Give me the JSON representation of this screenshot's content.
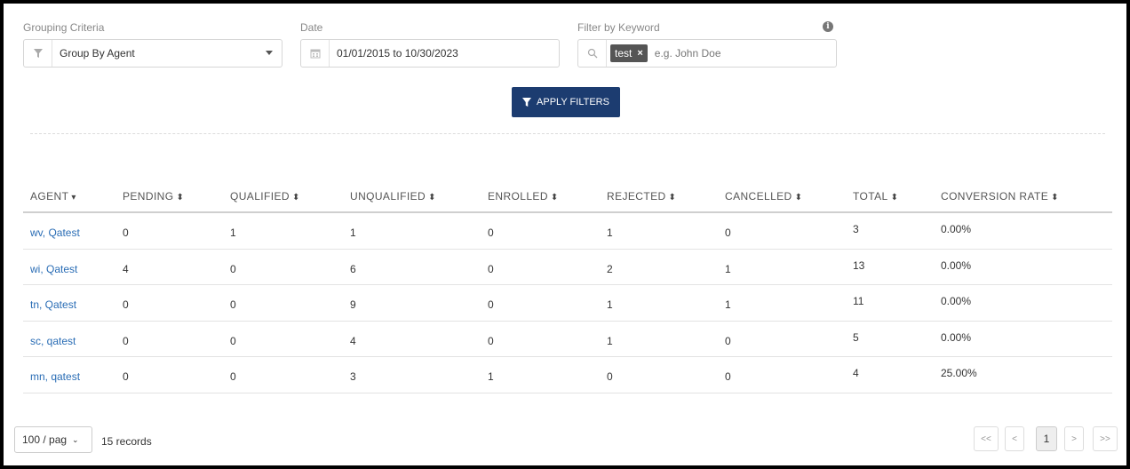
{
  "filters": {
    "grouping": {
      "label": "Grouping Criteria",
      "value": "Group By Agent"
    },
    "date": {
      "label": "Date",
      "value": "01/01/2015 to 10/30/2023"
    },
    "keyword": {
      "label": "Filter by Keyword",
      "tag": "test",
      "tag_remove": "×",
      "placeholder": "e.g. John Doe",
      "info": "i"
    },
    "apply_label": "APPLY FILTERS"
  },
  "table": {
    "headers": [
      {
        "label": "AGENT",
        "sort": "▾"
      },
      {
        "label": "PENDING",
        "sort": "⬍"
      },
      {
        "label": "QUALIFIED",
        "sort": "⬍"
      },
      {
        "label": "UNQUALIFIED",
        "sort": "⬍"
      },
      {
        "label": "ENROLLED",
        "sort": "⬍"
      },
      {
        "label": "REJECTED",
        "sort": "⬍"
      },
      {
        "label": "CANCELLED",
        "sort": "⬍"
      },
      {
        "label": "TOTAL",
        "sort": "⬍"
      },
      {
        "label": "CONVERSION RATE",
        "sort": "⬍"
      }
    ],
    "rows": [
      [
        "wv, Qatest",
        "0",
        "1",
        "1",
        "0",
        "1",
        "0",
        "3",
        "0.00%"
      ],
      [
        "wi, Qatest",
        "4",
        "0",
        "6",
        "0",
        "2",
        "1",
        "13",
        "0.00%"
      ],
      [
        "tn, Qatest",
        "0",
        "0",
        "9",
        "0",
        "1",
        "1",
        "11",
        "0.00%"
      ],
      [
        "sc, qatest",
        "0",
        "0",
        "4",
        "0",
        "1",
        "0",
        "5",
        "0.00%"
      ],
      [
        "mn, qatest",
        "0",
        "0",
        "3",
        "1",
        "0",
        "0",
        "4",
        "25.00%"
      ]
    ]
  },
  "footer": {
    "page_size": "100 / pag",
    "records": "15 records",
    "pager": {
      "first": "<<",
      "prev": "<",
      "current": "1",
      "next": ">",
      "last": ">>"
    }
  },
  "colors": {
    "primary": "#1c3c70",
    "link": "#2a6db5"
  }
}
